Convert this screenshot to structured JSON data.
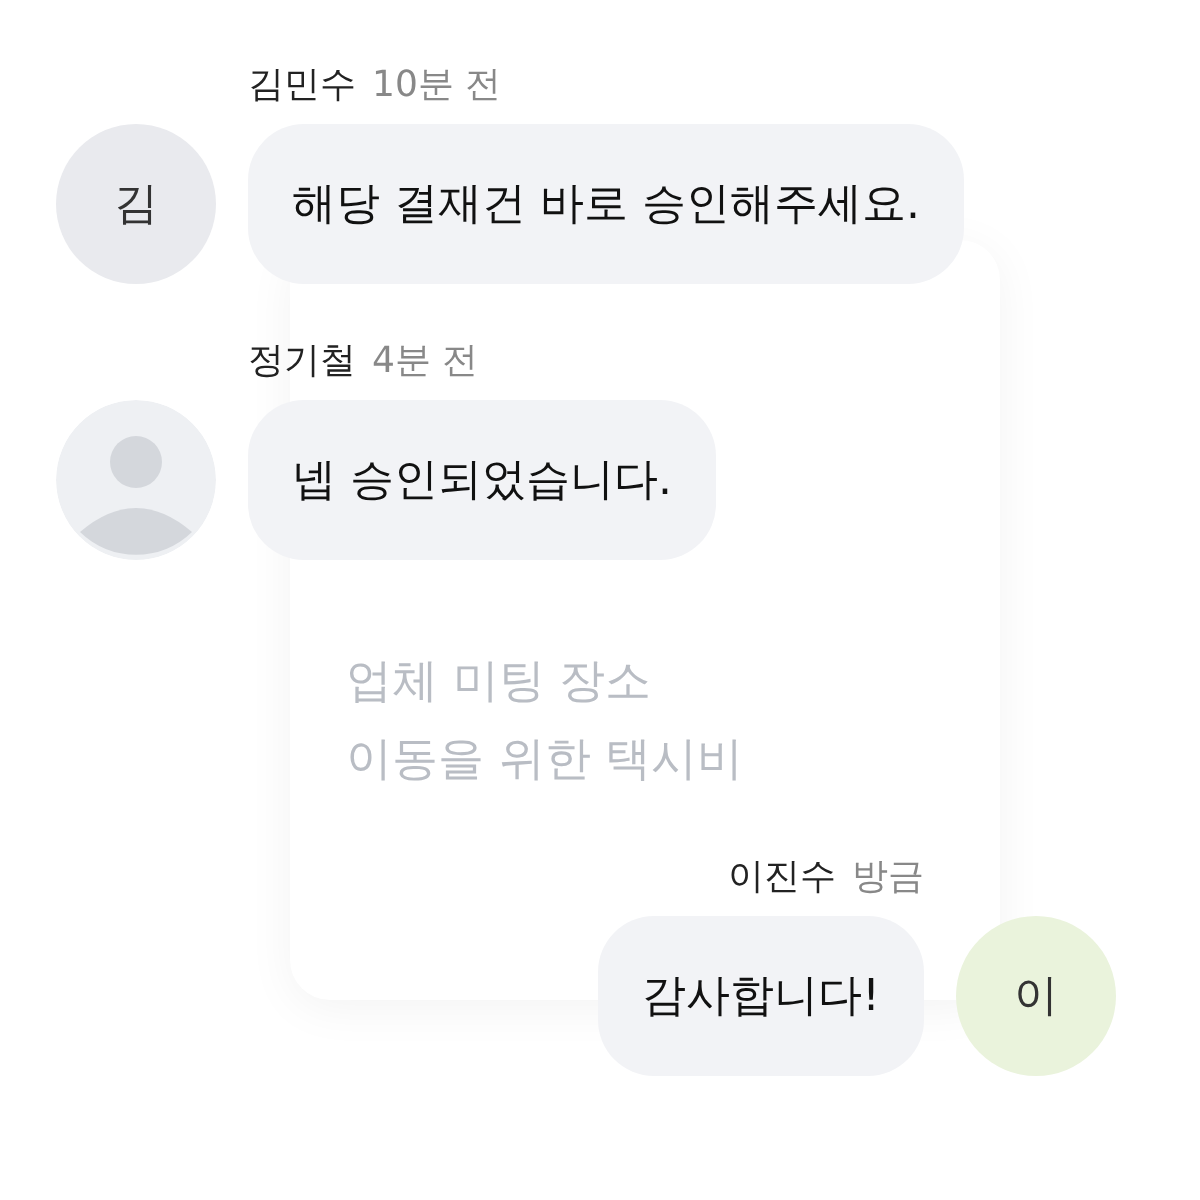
{
  "background_card": {
    "description_lines": [
      "업체 미팅 장소",
      "이동을 위한 택시비"
    ]
  },
  "messages": [
    {
      "sender": "김민수",
      "time": "10분 전",
      "text": "해당 결재건 바로 승인해주세요.",
      "mine": false,
      "avatar": {
        "kind": "initial",
        "initial": "김",
        "color": "#e9eaee"
      }
    },
    {
      "sender": "정기철",
      "time": "4분 전",
      "text": "넵 승인되었습니다.",
      "mine": false,
      "avatar": {
        "kind": "silhouette"
      }
    },
    {
      "sender": "이진수",
      "time": "방금",
      "text": "감사합니다!",
      "mine": true,
      "avatar": {
        "kind": "initial",
        "initial": "이",
        "color": "#eaf3dc"
      }
    }
  ]
}
